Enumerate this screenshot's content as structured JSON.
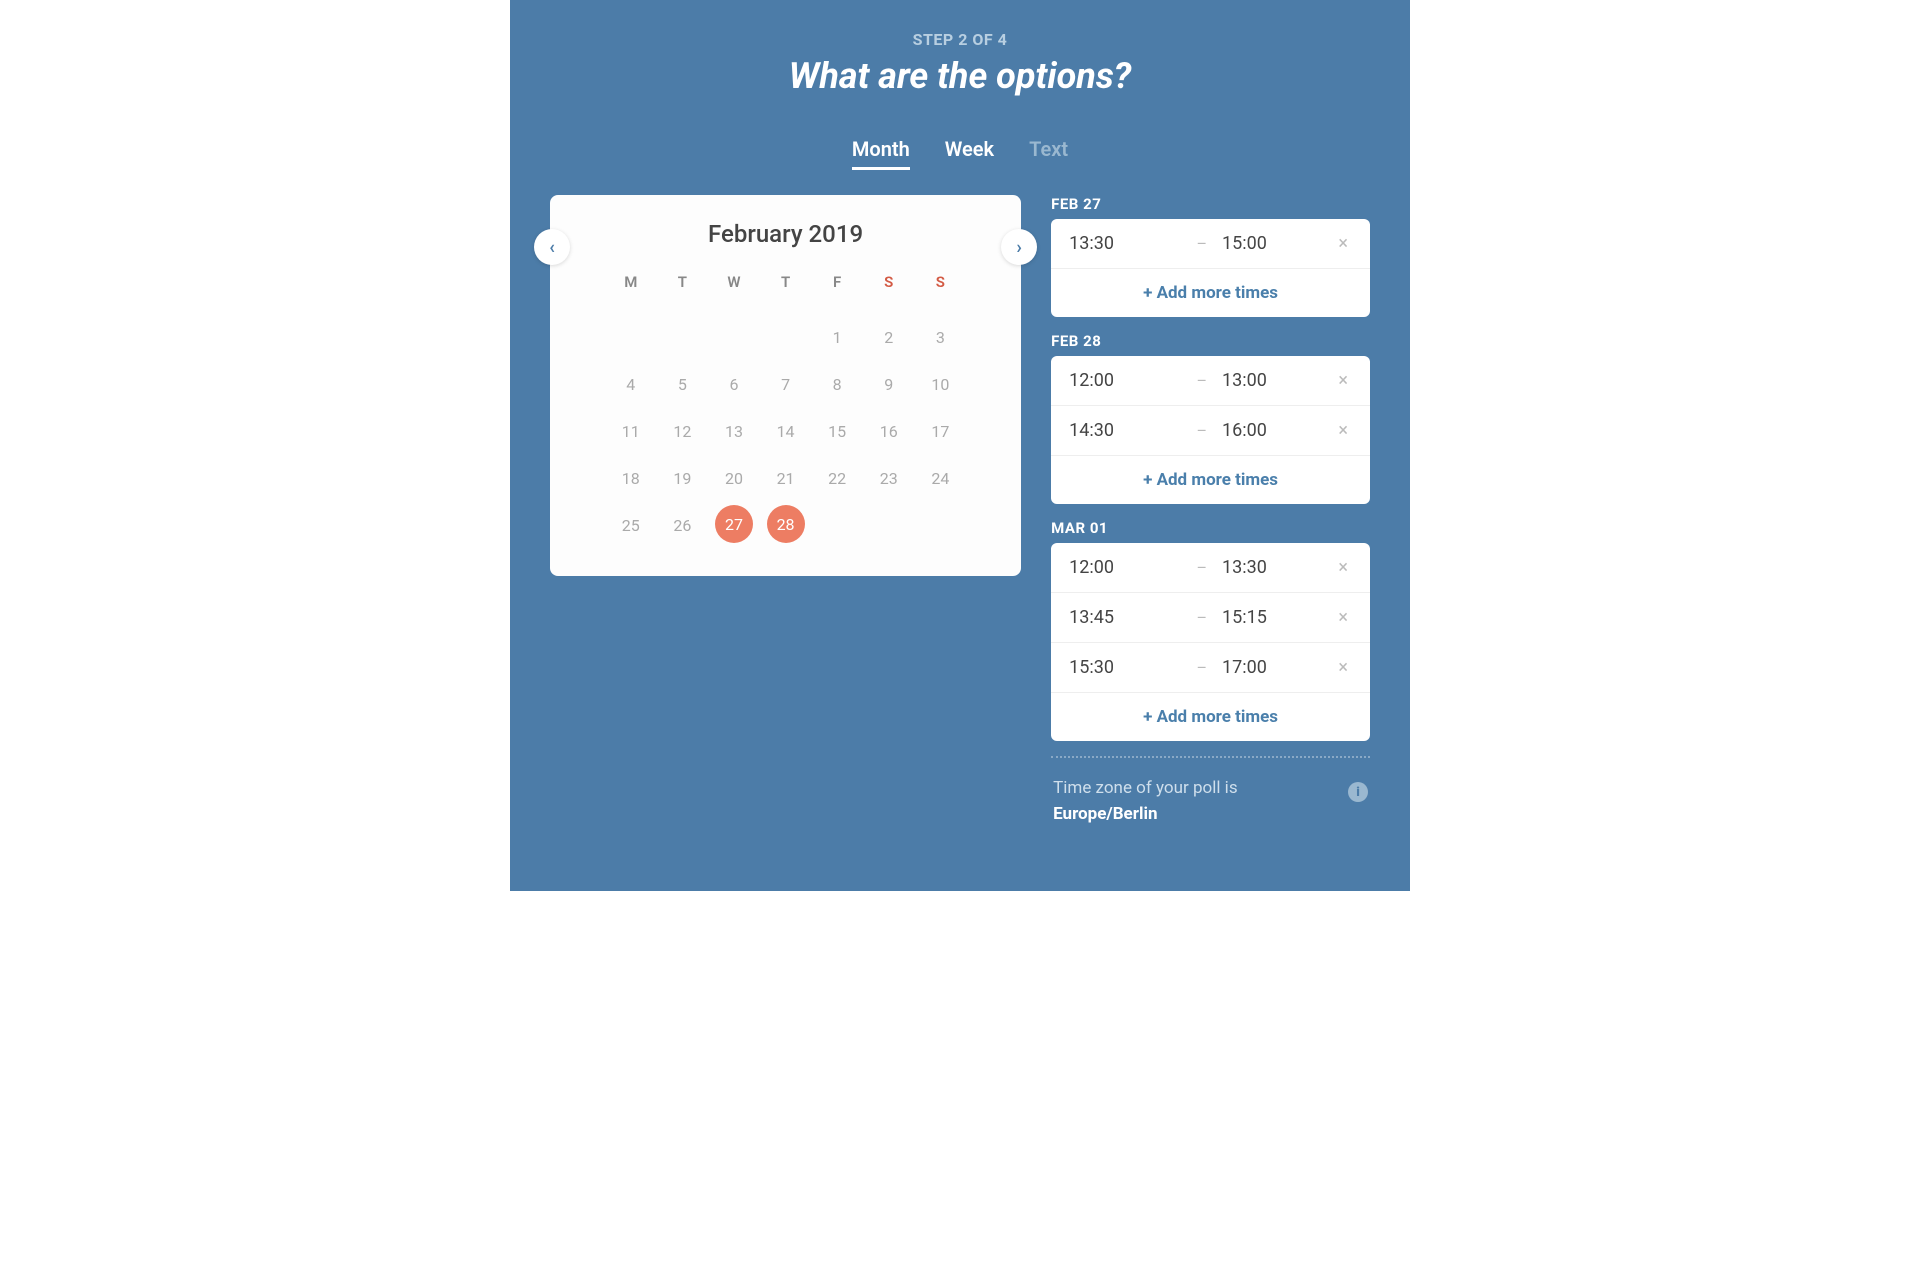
{
  "header": {
    "step_label": "STEP 2 OF 4",
    "heading": "What are the options?"
  },
  "tabs": {
    "month": "Month",
    "week": "Week",
    "text": "Text"
  },
  "calendar": {
    "title": "February 2019",
    "dow": [
      "M",
      "T",
      "W",
      "T",
      "F",
      "S",
      "S"
    ],
    "weeks": [
      [
        "",
        "",
        "",
        "",
        "1",
        "2",
        "3"
      ],
      [
        "4",
        "5",
        "6",
        "7",
        "8",
        "9",
        "10"
      ],
      [
        "11",
        "12",
        "13",
        "14",
        "15",
        "16",
        "17"
      ],
      [
        "18",
        "19",
        "20",
        "21",
        "22",
        "23",
        "24"
      ],
      [
        "25",
        "26",
        "27",
        "28",
        "",
        "",
        ""
      ]
    ],
    "selected": [
      "27",
      "28"
    ]
  },
  "slots": [
    {
      "label": "FEB 27",
      "times": [
        {
          "start": "13:30",
          "end": "15:00"
        }
      ],
      "add_label": "+ Add more times"
    },
    {
      "label": "FEB 28",
      "times": [
        {
          "start": "12:00",
          "end": "13:00"
        },
        {
          "start": "14:30",
          "end": "16:00"
        }
      ],
      "add_label": "+ Add more times"
    },
    {
      "label": "MAR 01",
      "times": [
        {
          "start": "12:00",
          "end": "13:30"
        },
        {
          "start": "13:45",
          "end": "15:15"
        },
        {
          "start": "15:30",
          "end": "17:00"
        }
      ],
      "add_label": "+ Add more times"
    }
  ],
  "timezone": {
    "prefix": "Time zone of your poll is",
    "zone": "Europe/Berlin"
  },
  "colors": {
    "background": "#4c7ca8",
    "accent": "#ed7d63",
    "link": "#4a7fab"
  }
}
